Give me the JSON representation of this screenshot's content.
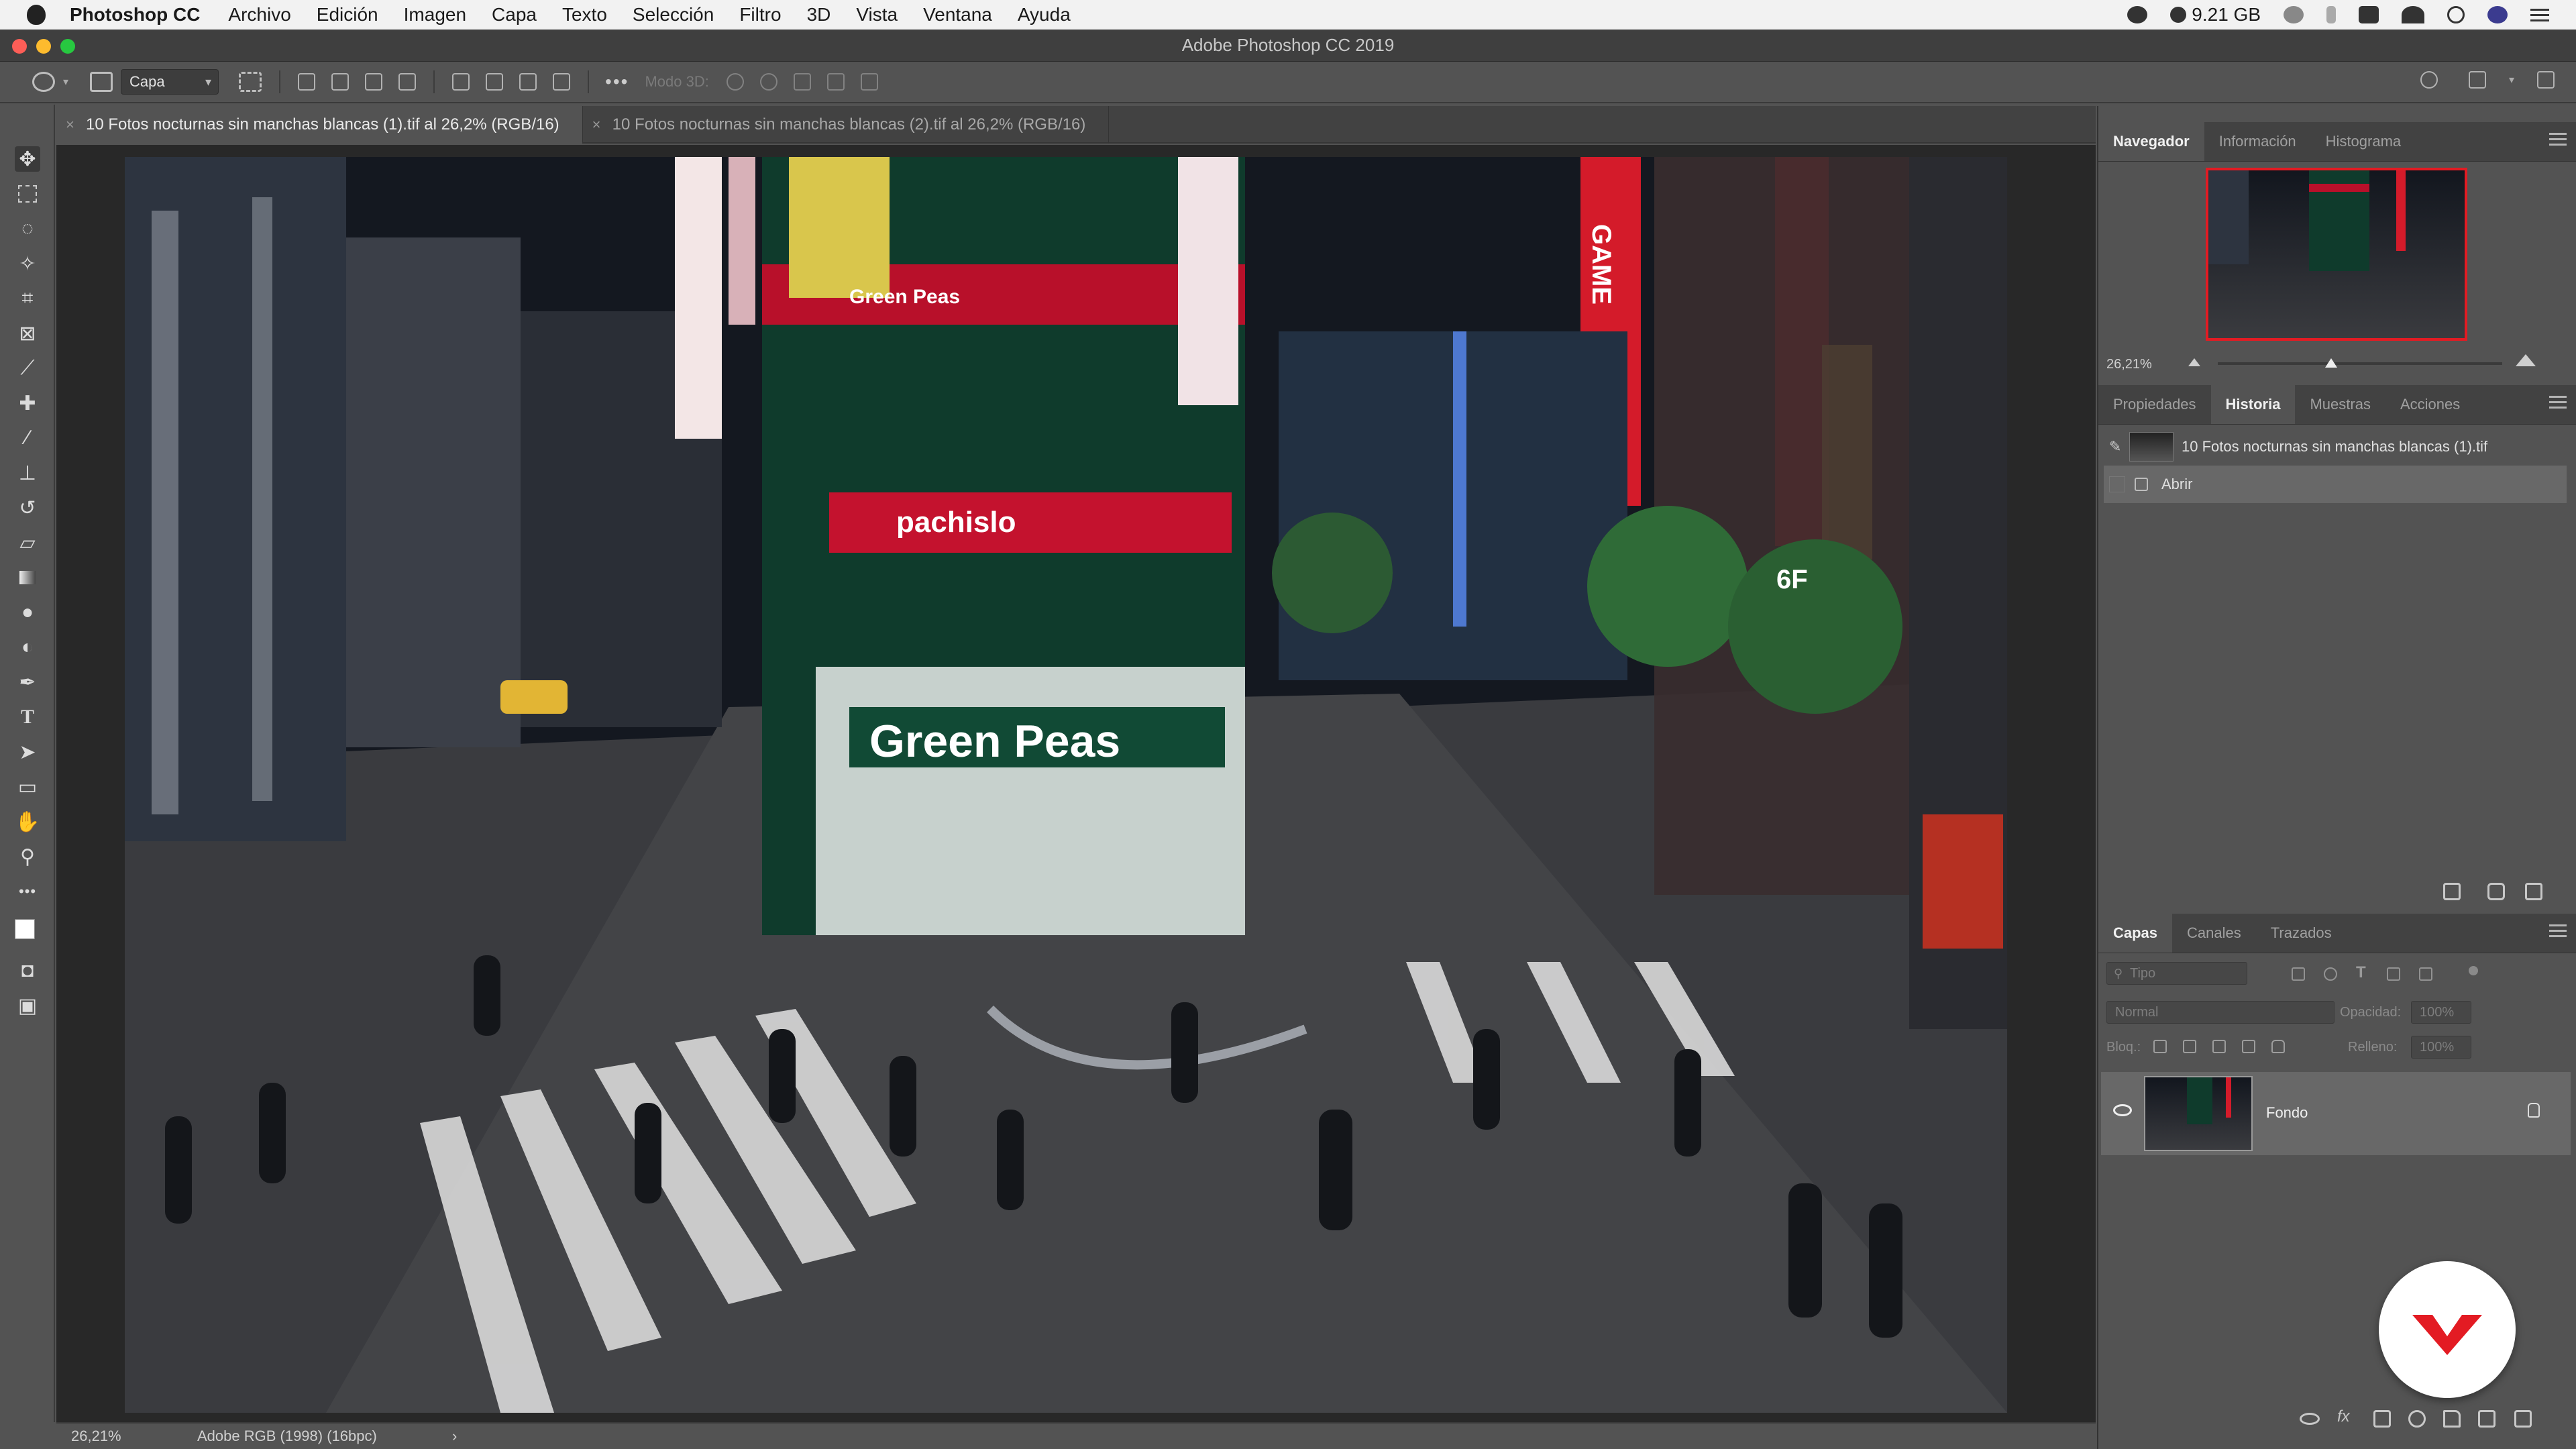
{
  "menubar": {
    "app_name": "Photoshop CC",
    "items": [
      "Archivo",
      "Edición",
      "Imagen",
      "Capa",
      "Texto",
      "Selección",
      "Filtro",
      "3D",
      "Vista",
      "Ventana",
      "Ayuda"
    ],
    "storage": "9.21 GB"
  },
  "window": {
    "title": "Adobe Photoshop CC 2019"
  },
  "options_bar": {
    "layer_select": "Capa",
    "mode_3d_label": "Modo 3D:"
  },
  "tabs": [
    {
      "label": "10 Fotos nocturnas sin manchas blancas (1).tif al 26,2% (RGB/16)"
    },
    {
      "label": "10 Fotos nocturnas sin manchas blancas (2).tif al 26,2% (RGB/16)"
    }
  ],
  "canvas": {
    "photo_signs": [
      "Green Peas",
      "Green Peas",
      "pachislo",
      "GAME",
      "6F"
    ]
  },
  "statusbar": {
    "zoom": "26,21%",
    "profile": "Adobe RGB (1998) (16bpc)",
    "arrow": "›"
  },
  "navigator_panel": {
    "tabs": [
      "Navegador",
      "Información",
      "Histograma"
    ],
    "zoom": "26,21%"
  },
  "history_panel": {
    "tabs": [
      "Propiedades",
      "Historia",
      "Muestras",
      "Acciones"
    ],
    "snapshot_label": "10 Fotos nocturnas sin manchas blancas (1).tif",
    "step_label": "Abrir"
  },
  "layers_panel": {
    "tabs": [
      "Capas",
      "Canales",
      "Trazados"
    ],
    "filter_placeholder": "Tipo",
    "blend_mode": "Normal",
    "opacity_label": "Opacidad:",
    "opacity_value": "100%",
    "lock_label": "Bloq.:",
    "fill_label": "Relleno:",
    "fill_value": "100%",
    "layer_name": "Fondo"
  },
  "colors": {
    "accent_red": "#e31b23",
    "panel_bg": "#535353",
    "tab_bg": "#424242"
  }
}
